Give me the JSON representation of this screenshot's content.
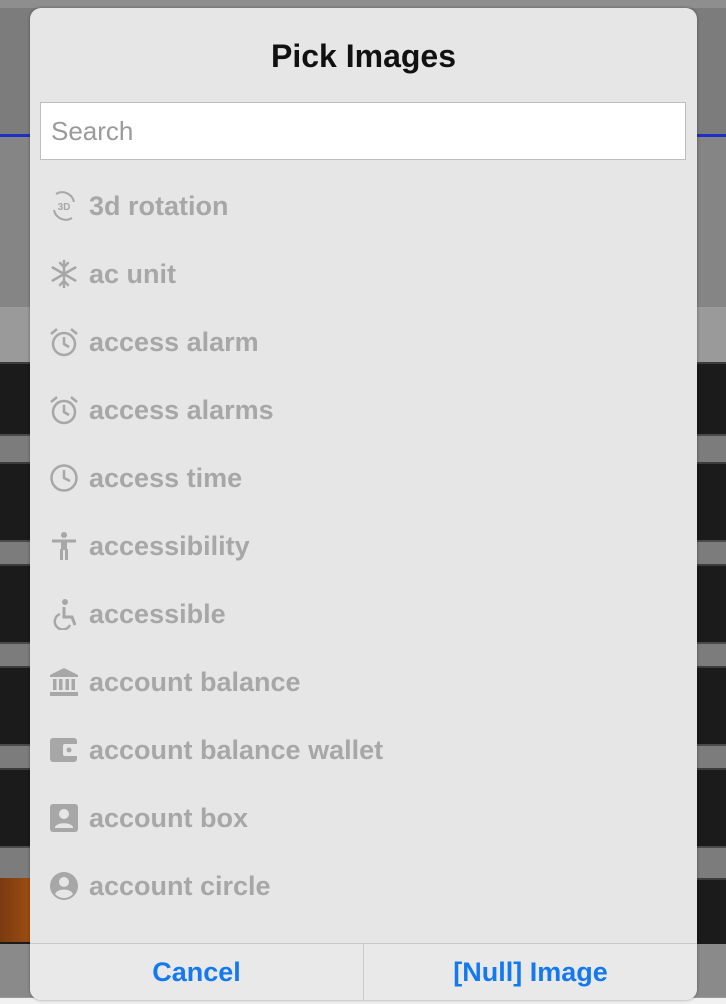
{
  "dialog": {
    "title": "Pick Images",
    "search": {
      "placeholder": "Search",
      "value": ""
    },
    "items": [
      {
        "label": "3d rotation",
        "icon": "3d-rotation-icon"
      },
      {
        "label": "ac unit",
        "icon": "ac-unit-icon"
      },
      {
        "label": "access alarm",
        "icon": "alarm-icon"
      },
      {
        "label": "access alarms",
        "icon": "alarms-icon"
      },
      {
        "label": "access time",
        "icon": "clock-icon"
      },
      {
        "label": "accessibility",
        "icon": "accessibility-icon"
      },
      {
        "label": "accessible",
        "icon": "wheelchair-icon"
      },
      {
        "label": "account balance",
        "icon": "bank-icon"
      },
      {
        "label": "account balance wallet",
        "icon": "wallet-icon"
      },
      {
        "label": "account box",
        "icon": "account-box-icon"
      },
      {
        "label": "account circle",
        "icon": "account-circle-icon"
      }
    ],
    "footer": {
      "cancel": "Cancel",
      "null_image": "[Null] Image"
    }
  },
  "colors": {
    "accent": "#1479ee",
    "item_text": "#a7a7a7",
    "dialog_bg": "#e6e6e6"
  }
}
